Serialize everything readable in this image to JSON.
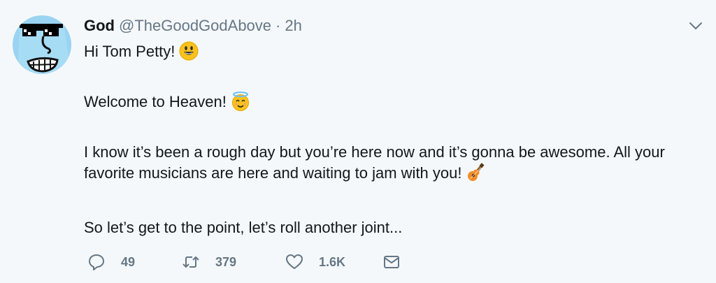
{
  "tweet": {
    "display_name": "God",
    "handle": "@TheGoodGodAbove",
    "separator": "·",
    "time": "2h",
    "paragraphs": [
      "Hi Tom Petty!",
      "Welcome to Heaven!",
      "I know it’s been a rough day but you’re here now and it’s gonna be awesome. All your favorite musicians are here and waiting to jam with you!",
      "So let’s get to the point, let’s roll another joint..."
    ],
    "emoji": [
      "smiley-emoji",
      "halo-smile-emoji",
      "guitar-emoji"
    ]
  },
  "actions": {
    "replies": "49",
    "retweets": "379",
    "likes": "1.6K"
  },
  "icons": {
    "avatar": "avatar-sunglasses-face",
    "menu": "chevron-down-icon",
    "reply": "reply-icon",
    "retweet": "retweet-icon",
    "like": "heart-icon",
    "dm": "envelope-icon"
  },
  "colors": {
    "background": "#f5f8fa",
    "text": "#14171a",
    "muted": "#657786",
    "avatar_bg": "#9ad4f2"
  }
}
